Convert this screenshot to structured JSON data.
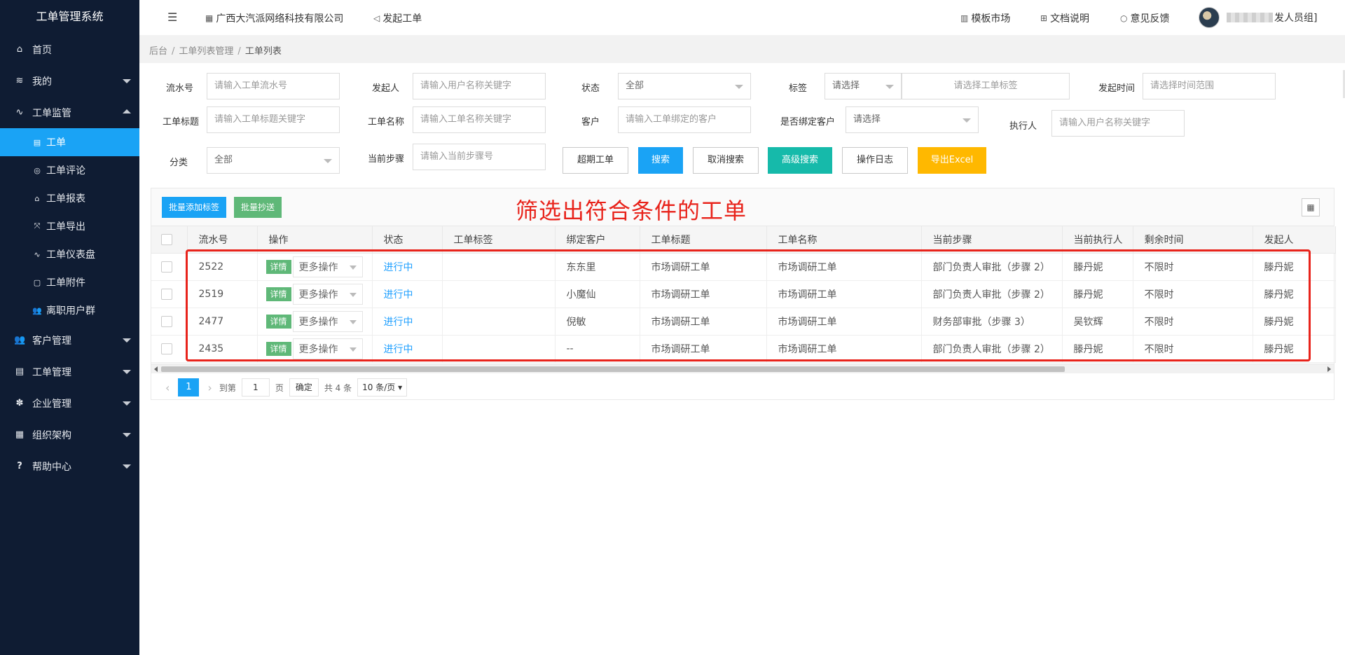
{
  "sidebar": {
    "title": "工单管理系统",
    "items": [
      {
        "label": "首页",
        "icon": "home-icon",
        "glyph": "⌂"
      },
      {
        "label": "我的",
        "icon": "layers-icon",
        "glyph": "≋"
      },
      {
        "label": "工单监管",
        "icon": "pulse-icon",
        "glyph": "∿"
      },
      {
        "label": "客户管理",
        "icon": "users-icon",
        "glyph": "👥"
      },
      {
        "label": "工单管理",
        "icon": "clipboard-icon",
        "glyph": "▤"
      },
      {
        "label": "企业管理",
        "icon": "gear-icon",
        "glyph": "✽"
      },
      {
        "label": "组织架构",
        "icon": "calendar-icon",
        "glyph": "▦"
      },
      {
        "label": "帮助中心",
        "icon": "question-icon",
        "glyph": "?"
      }
    ],
    "sub_items": [
      {
        "label": "工单",
        "icon": "document-icon",
        "glyph": "▤"
      },
      {
        "label": "工单评论",
        "icon": "comment-icon",
        "glyph": "◎"
      },
      {
        "label": "工单报表",
        "icon": "home-icon",
        "glyph": "⌂"
      },
      {
        "label": "工单导出",
        "icon": "export-icon",
        "glyph": "⤧"
      },
      {
        "label": "工单仪表盘",
        "icon": "pulse-icon",
        "glyph": "∿"
      },
      {
        "label": "工单附件",
        "icon": "file-icon",
        "glyph": "▢"
      },
      {
        "label": "离职用户群",
        "icon": "users-icon",
        "glyph": "👥"
      }
    ]
  },
  "header": {
    "company": "广西大汽派网络科技有限公司",
    "create_ticket": "发起工单",
    "template_market": "模板市场",
    "docs": "文档说明",
    "feedback": "意见反馈",
    "user_suffix": "发人员组]"
  },
  "breadcrumb": {
    "root": "后台",
    "parent": "工单列表管理",
    "current": "工单列表",
    "sep": "/"
  },
  "filters": {
    "serial_label": "流水号",
    "serial_placeholder": "请输入工单流水号",
    "initiator_label": "发起人",
    "initiator_placeholder": "请输入用户名称关键字",
    "status_label": "状态",
    "status_value": "全部",
    "tag_label": "标签",
    "tag_select": "请选择",
    "tag_placeholder": "请选择工单标签",
    "time_label": "发起时间",
    "time_placeholder": "请选择时间范围",
    "title_label": "工单标题",
    "title_placeholder": "请输入工单标题关键字",
    "name_label": "工单名称",
    "name_placeholder": "请输入工单名称关键字",
    "customer_label": "客户",
    "customer_placeholder": "请输入工单绑定的客户",
    "bound_label": "是否绑定客户",
    "bound_value": "请选择",
    "executor_label": "执行人",
    "executor_placeholder": "请输入用户名称关键字",
    "category_label": "分类",
    "category_value": "全部",
    "step_label": "当前步骤",
    "step_placeholder": "请输入当前步骤号"
  },
  "buttons": {
    "overdue": "超期工单",
    "search": "搜索",
    "cancel_search": "取消搜索",
    "advanced": "高级搜索",
    "log": "操作日志",
    "export": "导出Excel"
  },
  "toolbar": {
    "batch_tag": "批量添加标签",
    "batch_cc": "批量抄送"
  },
  "annotation": "筛选出符合条件的工单",
  "table": {
    "columns": [
      "流水号",
      "操作",
      "状态",
      "工单标签",
      "绑定客户",
      "工单标题",
      "工单名称",
      "当前步骤",
      "当前执行人",
      "剩余时间",
      "发起人"
    ],
    "detail_label": "详情",
    "more_label": "更多操作",
    "rows": [
      {
        "id": "2522",
        "status": "进行中",
        "tag": "",
        "customer": "东东里",
        "title": "市场调研工单",
        "name": "市场调研工单",
        "step": "部门负责人审批（步骤 2）",
        "executor": "滕丹妮",
        "remaining": "不限时",
        "initiator": "滕丹妮"
      },
      {
        "id": "2519",
        "status": "进行中",
        "tag": "",
        "customer": "小魔仙",
        "title": "市场调研工单",
        "name": "市场调研工单",
        "step": "部门负责人审批（步骤 2）",
        "executor": "滕丹妮",
        "remaining": "不限时",
        "initiator": "滕丹妮"
      },
      {
        "id": "2477",
        "status": "进行中",
        "tag": "",
        "customer": "倪敏",
        "title": "市场调研工单",
        "name": "市场调研工单",
        "step": "财务部审批（步骤 3）",
        "executor": "吴钦辉",
        "remaining": "不限时",
        "initiator": "滕丹妮"
      },
      {
        "id": "2435",
        "status": "进行中",
        "tag": "",
        "customer": "--",
        "title": "市场调研工单",
        "name": "市场调研工单",
        "step": "部门负责人审批（步骤 2）",
        "executor": "滕丹妮",
        "remaining": "不限时",
        "initiator": "滕丹妮"
      }
    ]
  },
  "pager": {
    "current_page": "1",
    "goto_label": "到第",
    "goto_value": "1",
    "page_unit": "页",
    "confirm": "确定",
    "total": "共 4 条",
    "page_size": "10 条/页"
  },
  "colors": {
    "sidebar_bg": "#0f1c33",
    "active": "#1aa3f5",
    "annotation_red": "#e8231b",
    "detail_green": "#5fb878",
    "status_blue": "#1e9fff"
  }
}
